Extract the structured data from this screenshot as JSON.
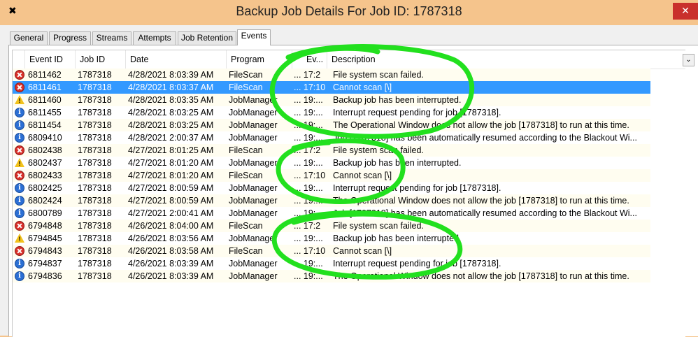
{
  "window": {
    "title": "Backup Job Details For Job ID: 1787318",
    "app_icon": "✖",
    "close_label": "✕"
  },
  "tabs": [
    {
      "label": "General",
      "active": false
    },
    {
      "label": "Progress",
      "active": false
    },
    {
      "label": "Streams",
      "active": false
    },
    {
      "label": "Attempts",
      "active": false
    },
    {
      "label": "Job Retention",
      "active": false
    },
    {
      "label": "Events",
      "active": true
    }
  ],
  "columns": [
    "Event ID",
    "Job ID",
    "Date",
    "Program",
    "Ev...",
    "Description"
  ],
  "scroll_button": "⌄",
  "colors": {
    "selection": "#3399ff",
    "annotation": "#22e01e",
    "error": "#d9302a",
    "info": "#2c6fd4",
    "warning": "#f2c21b"
  },
  "events": [
    {
      "severity": "error",
      "event_id": "6811462",
      "job_id": "1787318",
      "date": "4/28/2021 8:03:39 AM",
      "program": "FileScan",
      "ev": "... 17:2",
      "description": "File system scan failed."
    },
    {
      "severity": "error",
      "event_id": "6811461",
      "job_id": "1787318",
      "date": "4/28/2021 8:03:37 AM",
      "program": "FileScan",
      "ev": "... 17:10",
      "description": "Cannot scan [\\]",
      "selected": true
    },
    {
      "severity": "warning",
      "event_id": "6811460",
      "job_id": "1787318",
      "date": "4/28/2021 8:03:35 AM",
      "program": "JobManager",
      "ev": "... 19:...",
      "description": "Backup job has been interrupted."
    },
    {
      "severity": "info",
      "event_id": "6811455",
      "job_id": "1787318",
      "date": "4/28/2021 8:03:25 AM",
      "program": "JobManager",
      "ev": "... 19:...",
      "description": "Interrupt request pending for job [1787318]."
    },
    {
      "severity": "info",
      "event_id": "6811454",
      "job_id": "1787318",
      "date": "4/28/2021 8:03:25 AM",
      "program": "JobManager",
      "ev": "... 19:...",
      "description": "The Operational Window does not allow the job [1787318] to run at this time."
    },
    {
      "severity": "info",
      "event_id": "6809410",
      "job_id": "1787318",
      "date": "4/28/2021 2:00:37 AM",
      "program": "JobManager",
      "ev": "... 19:...",
      "description": "Job [1787318] has been automatically resumed according to the Blackout Wi..."
    },
    {
      "severity": "error",
      "event_id": "6802438",
      "job_id": "1787318",
      "date": "4/27/2021 8:01:25 AM",
      "program": "FileScan",
      "ev": "... 17:2",
      "description": "File system scan failed."
    },
    {
      "severity": "warning",
      "event_id": "6802437",
      "job_id": "1787318",
      "date": "4/27/2021 8:01:20 AM",
      "program": "JobManager",
      "ev": "... 19:...",
      "description": "Backup job has been interrupted."
    },
    {
      "severity": "error",
      "event_id": "6802433",
      "job_id": "1787318",
      "date": "4/27/2021 8:01:20 AM",
      "program": "FileScan",
      "ev": "... 17:10",
      "description": "Cannot scan [\\]"
    },
    {
      "severity": "info",
      "event_id": "6802425",
      "job_id": "1787318",
      "date": "4/27/2021 8:00:59 AM",
      "program": "JobManager",
      "ev": "... 19:...",
      "description": "Interrupt request pending for job [1787318]."
    },
    {
      "severity": "info",
      "event_id": "6802424",
      "job_id": "1787318",
      "date": "4/27/2021 8:00:59 AM",
      "program": "JobManager",
      "ev": "... 19:...",
      "description": "The Operational Window does not allow the job [1787318] to run at this time."
    },
    {
      "severity": "info",
      "event_id": "6800789",
      "job_id": "1787318",
      "date": "4/27/2021 2:00:41 AM",
      "program": "JobManager",
      "ev": "... 19:...",
      "description": "Job [1787318] has been automatically resumed according to the Blackout Wi..."
    },
    {
      "severity": "error",
      "event_id": "6794848",
      "job_id": "1787318",
      "date": "4/26/2021 8:04:00 AM",
      "program": "FileScan",
      "ev": "... 17:2",
      "description": "File system scan failed."
    },
    {
      "severity": "warning",
      "event_id": "6794845",
      "job_id": "1787318",
      "date": "4/26/2021 8:03:56 AM",
      "program": "JobManager",
      "ev": "... 19:...",
      "description": "Backup job has been interrupted."
    },
    {
      "severity": "error",
      "event_id": "6794843",
      "job_id": "1787318",
      "date": "4/26/2021 8:03:58 AM",
      "program": "FileScan",
      "ev": "... 17:10",
      "description": "Cannot scan [\\]"
    },
    {
      "severity": "info",
      "event_id": "6794837",
      "job_id": "1787318",
      "date": "4/26/2021 8:03:39 AM",
      "program": "JobManager",
      "ev": "... 19:...",
      "description": "Interrupt request pending for job [1787318]."
    },
    {
      "severity": "info",
      "event_id": "6794836",
      "job_id": "1787318",
      "date": "4/26/2021 8:03:39 AM",
      "program": "JobManager",
      "ev": "... 19:...",
      "description": "The Operational Window does not allow the job [1787318] to run at this time."
    }
  ]
}
